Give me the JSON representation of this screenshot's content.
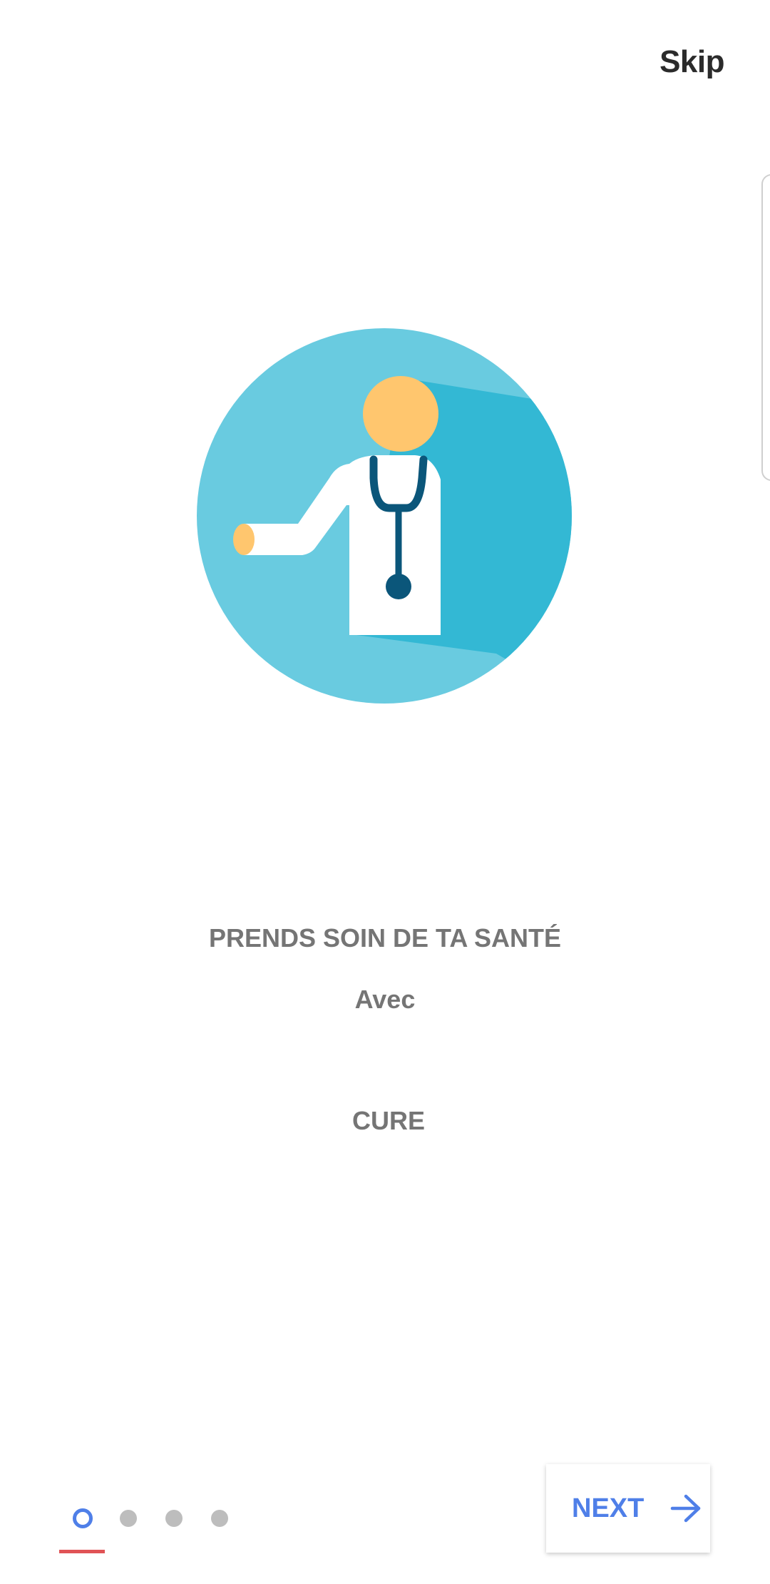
{
  "header": {
    "skip_label": "Skip"
  },
  "onboarding": {
    "title": "PRENDS SOIN DE TA SANTÉ",
    "subtitle": "Avec",
    "brand": "CURE",
    "illustration_icon": "doctor-with-stethoscope-icon"
  },
  "pager": {
    "current_page": 1,
    "total_pages": 4
  },
  "footer": {
    "next_label": "NEXT",
    "next_icon": "arrow-right-icon"
  },
  "colors": {
    "accent": "#4f7fe8",
    "indicator_underline": "#e05356",
    "circle_light": "#69cbe0",
    "circle_shadow": "#33b8d4",
    "skin": "#ffc66e",
    "stethoscope": "#0b567a",
    "text_gray": "#757575"
  }
}
